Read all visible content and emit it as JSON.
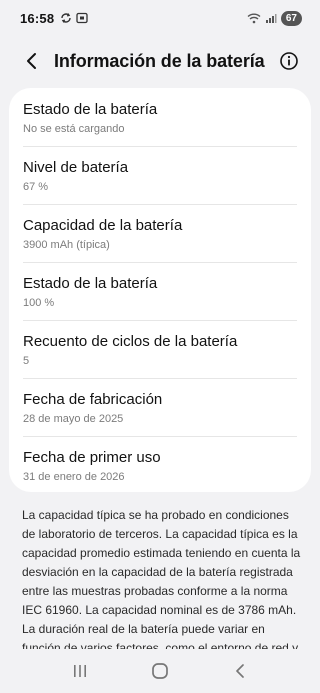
{
  "status_bar": {
    "time": "16:58",
    "battery_level": "67"
  },
  "header": {
    "title": "Información de la batería"
  },
  "battery_info": [
    {
      "label": "Estado de la batería",
      "value": "No se está cargando"
    },
    {
      "label": "Nivel de batería",
      "value": "67 %"
    },
    {
      "label": "Capacidad de la batería",
      "value": "3900 mAh (típica)"
    },
    {
      "label": "Estado de la batería",
      "value": "100 %"
    },
    {
      "label": "Recuento de ciclos de la batería",
      "value": "5"
    },
    {
      "label": "Fecha de fabricación",
      "value": "28 de mayo de 2025"
    },
    {
      "label": "Fecha de primer uso",
      "value": "31 de enero de 2026"
    }
  ],
  "description": "La capacidad típica se ha probado en condiciones de laboratorio de terceros. La capacidad típica es la capacidad promedio estimada teniendo en cuenta la desviación en la capacidad de la batería registrada entre las muestras probadas conforme a la norma IEC 61960. La capacidad nominal es de 3786 mAh. La duración real de la batería puede variar en función de varios factores, como el entorno de red y",
  "icons": {
    "back": "back-arrow-icon",
    "info": "info-icon",
    "nav_recents": "recents-icon",
    "nav_home": "home-icon",
    "nav_back": "nav-back-icon"
  }
}
